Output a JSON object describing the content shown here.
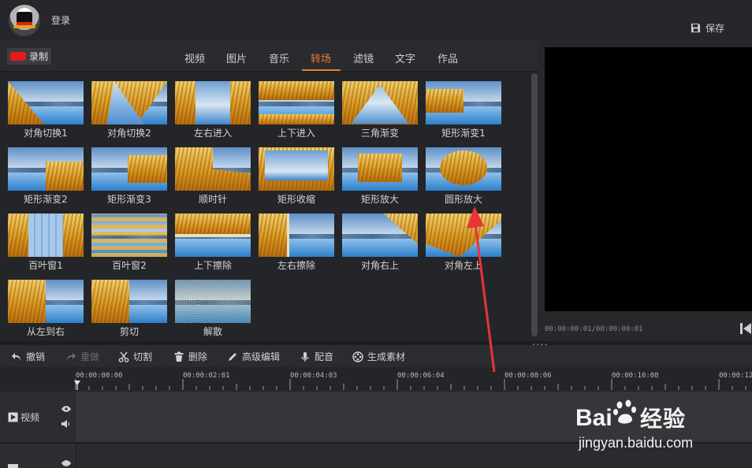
{
  "header": {
    "login_label": "登录",
    "save_label": "保存"
  },
  "tabs": {
    "record_label": "录制",
    "items": [
      "视频",
      "图片",
      "音乐",
      "转场",
      "滤镜",
      "文字",
      "作品"
    ],
    "active": "转场"
  },
  "transitions": [
    "对角切换1",
    "对角切换2",
    "左右进入",
    "上下进入",
    "三角渐变",
    "矩形渐变1",
    "矩形渐变2",
    "矩形渐变3",
    "顺时针",
    "矩形收缩",
    "矩形放大",
    "圆形放大",
    "百叶窗1",
    "百叶窗2",
    "上下擦除",
    "左右擦除",
    "对角右上",
    "对角左上",
    "从左到右",
    "剪切",
    "解散"
  ],
  "preview": {
    "time": "00:00:00:01/00:00:00:01"
  },
  "toolbar": {
    "undo": "撤销",
    "redo": "重做",
    "cut": "切割",
    "delete": "删除",
    "advanced_edit": "高级编辑",
    "dub": "配音",
    "generate": "生成素材"
  },
  "timeline": {
    "ticks": [
      "00:00:00:00",
      "00:00:02:01",
      "00:00:04:03",
      "00:00:06:04",
      "00:00:08:06",
      "00:00:10:08",
      "00:00:12"
    ],
    "video_track_label": "视频"
  },
  "watermark": {
    "brand": "Bai",
    "brand2": "经验",
    "url": "jingyan.baidu.com"
  },
  "colors": {
    "accent": "#f07b2a",
    "arrow": "#e8333a",
    "record": "#e61a1a"
  }
}
